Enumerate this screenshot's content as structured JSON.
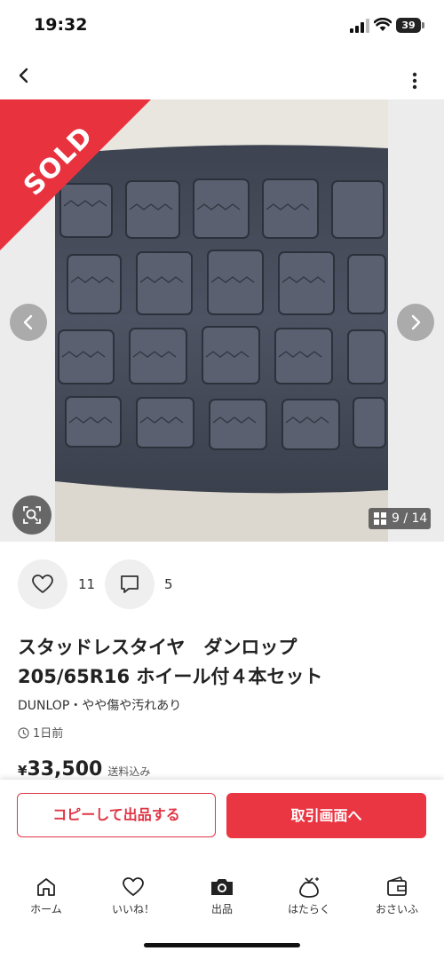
{
  "status": {
    "time": "19:32",
    "battery": "39"
  },
  "nav": {
    "back_icon": "chevron-left-icon",
    "more_icon": "more-vertical-icon"
  },
  "gallery": {
    "badge": "SOLD",
    "counter": "9 / 14"
  },
  "reactions": {
    "likes": "11",
    "comments": "5"
  },
  "item": {
    "title_line1": "スタッドレスタイヤ　ダンロップ",
    "title_line2": "205/65R16 ホイール付４本セット",
    "brand_condition": "DUNLOP・やや傷や汚れあり",
    "posted": "1日前",
    "currency": "¥",
    "price": "33,500",
    "shipping": "送料込み"
  },
  "actions": {
    "copy_label": "コピーして出品する",
    "trade_label": "取引画面へ"
  },
  "tabs": [
    {
      "label": "ホーム",
      "icon": "home-icon"
    },
    {
      "label": "いいね！",
      "icon": "heart-icon"
    },
    {
      "label": "出品",
      "icon": "camera-icon"
    },
    {
      "label": "はたらく",
      "icon": "money-bag-icon"
    },
    {
      "label": "おさいふ",
      "icon": "wallet-icon"
    }
  ],
  "colors": {
    "accent": "#ea3542",
    "sold_banner": "#e8333f"
  }
}
